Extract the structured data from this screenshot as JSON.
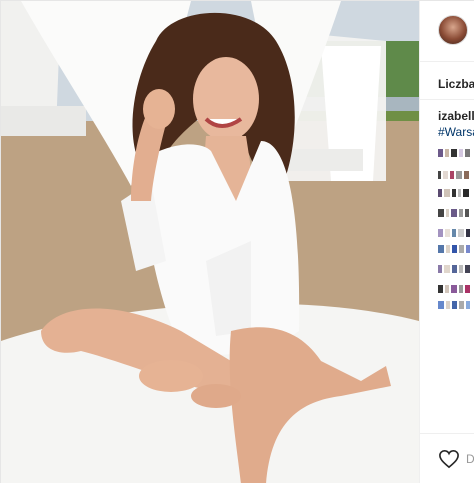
{
  "side": {
    "likes_label": "Liczba",
    "username": "izabella",
    "hashtag": "#Warsa",
    "comment_input_placeholder": "D"
  },
  "colors": {
    "hashtag": "#003569",
    "text": "#262626",
    "divider": "#efefef"
  },
  "icons": [
    "heart-icon",
    "avatar"
  ]
}
